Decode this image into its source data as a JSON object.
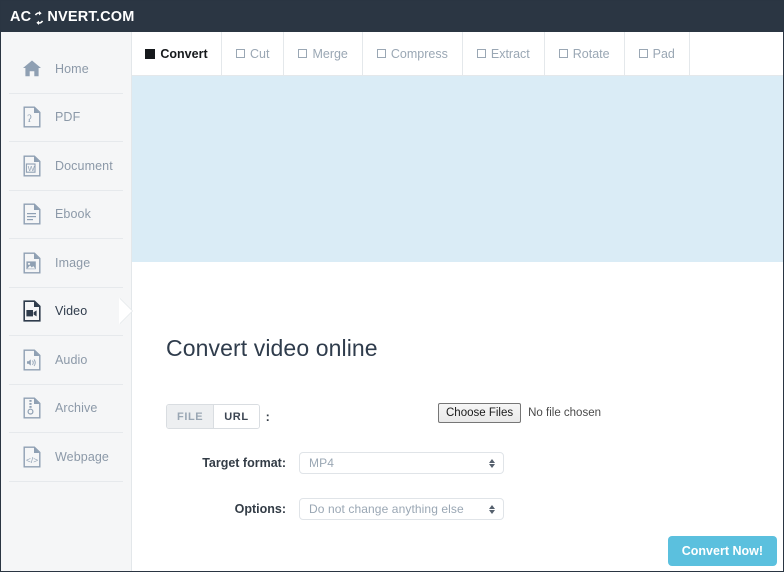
{
  "header": {
    "logo_pre": "AC",
    "logo_icon": "refresh-circular-arrows-icon",
    "logo_post": "NVERT.COM"
  },
  "sidebar": {
    "items": [
      {
        "label": "Home",
        "icon": "home-icon",
        "active": false
      },
      {
        "label": "PDF",
        "icon": "pdf-file-icon",
        "active": false
      },
      {
        "label": "Document",
        "icon": "word-document-icon",
        "active": false
      },
      {
        "label": "Ebook",
        "icon": "ebook-file-icon",
        "active": false
      },
      {
        "label": "Image",
        "icon": "image-file-icon",
        "active": false
      },
      {
        "label": "Video",
        "icon": "video-file-icon",
        "active": true
      },
      {
        "label": "Audio",
        "icon": "audio-file-icon",
        "active": false
      },
      {
        "label": "Archive",
        "icon": "archive-file-icon",
        "active": false
      },
      {
        "label": "Webpage",
        "icon": "webpage-code-icon",
        "active": false
      }
    ]
  },
  "tabs": [
    {
      "label": "Convert",
      "active": true
    },
    {
      "label": "Cut",
      "active": false
    },
    {
      "label": "Merge",
      "active": false
    },
    {
      "label": "Compress",
      "active": false
    },
    {
      "label": "Extract",
      "active": false
    },
    {
      "label": "Rotate",
      "active": false
    },
    {
      "label": "Pad",
      "active": false
    }
  ],
  "main": {
    "title": "Convert video online",
    "source_toggle": {
      "file_label": "FILE",
      "url_label": "URL",
      "selected": "URL",
      "separator": ":"
    },
    "file_input": {
      "button_label": "Choose Files",
      "status": "No file chosen"
    },
    "target_format": {
      "label": "Target format:",
      "value": "MP4"
    },
    "options": {
      "label": "Options:",
      "value": "Do not change anything else"
    },
    "submit_label": "Convert Now!"
  },
  "colors": {
    "header_bg": "#2b3643",
    "sidebar_bg": "#f5f6f7",
    "banner_bg": "#daecf6",
    "accent": "#5bc0de",
    "muted_text": "#9aa7b4",
    "dark_text": "#2f3c4c"
  }
}
